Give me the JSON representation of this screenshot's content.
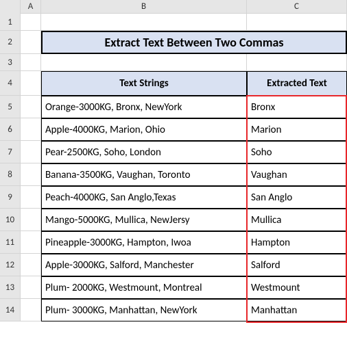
{
  "columns": {
    "A": "A",
    "B": "B",
    "C": "C"
  },
  "rowNums": [
    "1",
    "2",
    "3",
    "4",
    "5",
    "6",
    "7",
    "8",
    "9",
    "10",
    "11",
    "12",
    "13",
    "14"
  ],
  "title": "Extract Text Between Two Commas",
  "headers": {
    "b": "Text Strings",
    "c": "Extracted Text"
  },
  "rows": [
    {
      "b": "Orange-3000KG, Bronx, NewYork",
      "c": "Bronx"
    },
    {
      "b": "Apple-4000KG, Marion, Ohio",
      "c": "Marion"
    },
    {
      "b": "Pear-2500KG, Soho, London",
      "c": "Soho"
    },
    {
      "b": "Banana-3500KG, Vaughan, Toronto",
      "c": "Vaughan"
    },
    {
      "b": "Peach-4000KG, San Anglo,Texas",
      "c": "San Anglo"
    },
    {
      "b": "Mango-5000KG, Mullica, NewJersy",
      "c": "Mullica"
    },
    {
      "b": "Pineapple-3000KG, Hampton, Iwoa",
      "c": "Hampton"
    },
    {
      "b": "Apple-3000KG, Salford, Manchester",
      "c": "Salford"
    },
    {
      "b": "Plum- 2000KG, Westmount, Montreal",
      "c": "Westmount"
    },
    {
      "b": "Plum- 3000KG, Manhattan, NewYork",
      "c": "Manhattan"
    }
  ],
  "chart_data": {
    "type": "table",
    "title": "Extract Text Between Two Commas",
    "columns": [
      "Text Strings",
      "Extracted Text"
    ],
    "rows": [
      [
        "Orange-3000KG, Bronx, NewYork",
        "Bronx"
      ],
      [
        "Apple-4000KG, Marion, Ohio",
        "Marion"
      ],
      [
        "Pear-2500KG, Soho, London",
        "Soho"
      ],
      [
        "Banana-3500KG, Vaughan, Toronto",
        "Vaughan"
      ],
      [
        "Peach-4000KG, San Anglo,Texas",
        "San Anglo"
      ],
      [
        "Mango-5000KG, Mullica, NewJersy",
        "Mullica"
      ],
      [
        "Pineapple-3000KG, Hampton, Iwoa",
        "Hampton"
      ],
      [
        "Apple-3000KG, Salford, Manchester",
        "Salford"
      ],
      [
        "Plum- 2000KG, Westmount, Montreal",
        "Westmount"
      ],
      [
        "Plum- 3000KG, Manhattan, NewYork",
        "Manhattan"
      ]
    ]
  }
}
